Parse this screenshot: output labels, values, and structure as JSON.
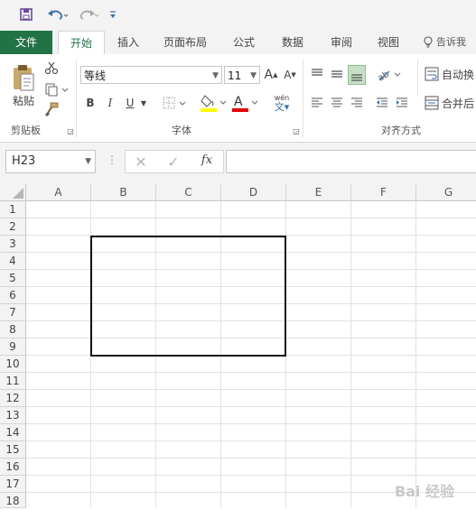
{
  "qat": {
    "save_icon": "save-icon",
    "undo_icon": "undo-icon",
    "redo_icon": "redo-icon",
    "customize_icon": "customize-qat-icon"
  },
  "tabs": [
    {
      "id": "file",
      "label": "文件"
    },
    {
      "id": "home",
      "label": "开始"
    },
    {
      "id": "insert",
      "label": "插入"
    },
    {
      "id": "layout",
      "label": "页面布局"
    },
    {
      "id": "formulas",
      "label": "公式"
    },
    {
      "id": "data",
      "label": "数据"
    },
    {
      "id": "review",
      "label": "审阅"
    },
    {
      "id": "view",
      "label": "视图"
    },
    {
      "id": "tellme",
      "label": "告诉我"
    }
  ],
  "ribbon": {
    "clipboard": {
      "paste_label": "粘贴",
      "group_label": "剪贴板"
    },
    "font": {
      "font_name": "等线",
      "font_size": "11",
      "bold": "B",
      "italic": "I",
      "underline": "U",
      "group_label": "字体",
      "phonetic": "wén"
    },
    "alignment": {
      "wrap_label": "自动换",
      "merge_label": "合并后",
      "group_label": "对齐方式"
    }
  },
  "formula_bar": {
    "name_box": "H23",
    "fx": "fx"
  },
  "grid": {
    "columns": [
      "A",
      "B",
      "C",
      "D",
      "E",
      "F",
      "G"
    ],
    "rows": [
      "1",
      "2",
      "3",
      "4",
      "5",
      "6",
      "7",
      "8",
      "9",
      "10",
      "11",
      "12",
      "13",
      "14",
      "15",
      "16",
      "17",
      "18"
    ]
  },
  "watermark": "Bai 经验"
}
